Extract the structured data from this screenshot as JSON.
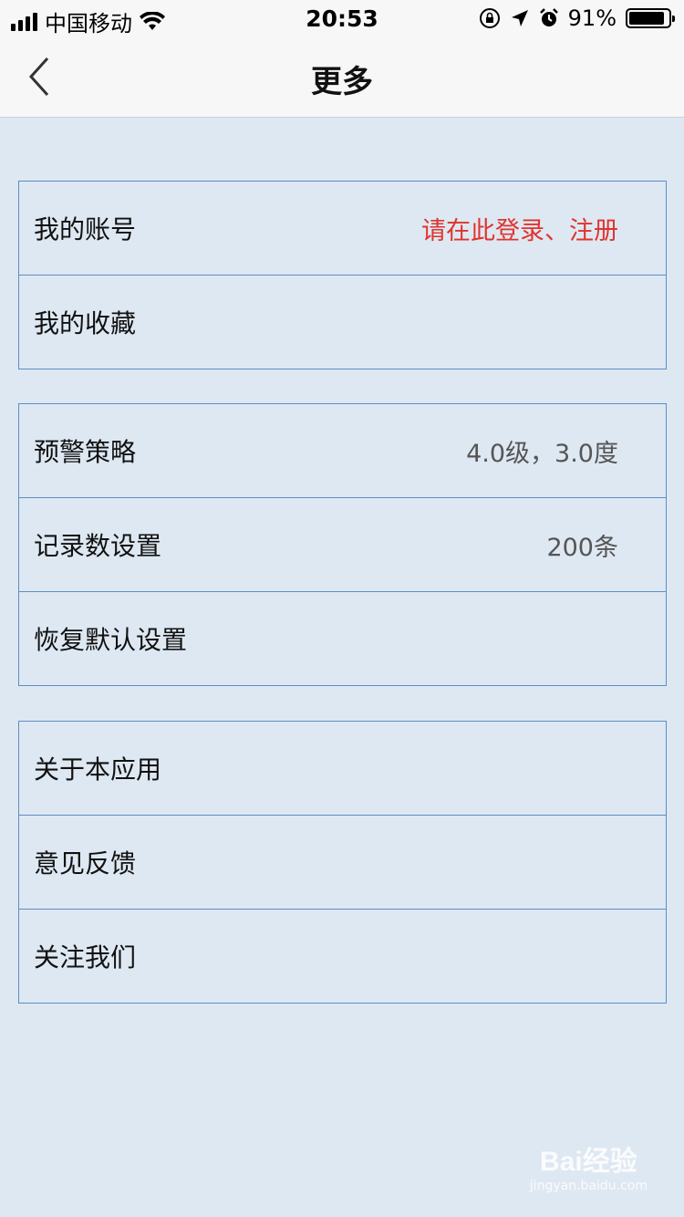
{
  "status_bar": {
    "carrier": "中国移动",
    "time": "20:53",
    "battery_percent": "91%",
    "battery_level": 0.91,
    "icons": [
      "signal-icon",
      "wifi-icon",
      "orientation-lock-icon",
      "location-icon",
      "alarm-icon",
      "battery-icon"
    ]
  },
  "nav": {
    "back_icon": "chevron-left-icon",
    "title": "更多"
  },
  "groups": [
    {
      "rows": [
        {
          "label": "我的账号",
          "value": "请在此登录、注册",
          "value_color": "#e0332d"
        },
        {
          "label": "我的收藏",
          "value": ""
        }
      ]
    },
    {
      "rows": [
        {
          "label": "预警策略",
          "value": "4.0级，3.0度"
        },
        {
          "label": "记录数设置",
          "value": "200条"
        },
        {
          "label": "恢复默认设置",
          "value": ""
        }
      ]
    },
    {
      "rows": [
        {
          "label": "关于本应用",
          "value": ""
        },
        {
          "label": "意见反馈",
          "value": ""
        },
        {
          "label": "关注我们",
          "value": ""
        }
      ]
    }
  ],
  "watermark": {
    "main": "Bai经验",
    "sub": "jingyan.baidu.com"
  },
  "colors": {
    "background": "#dee8f2",
    "border": "#5b8ec4",
    "accent_red": "#e0332d"
  }
}
